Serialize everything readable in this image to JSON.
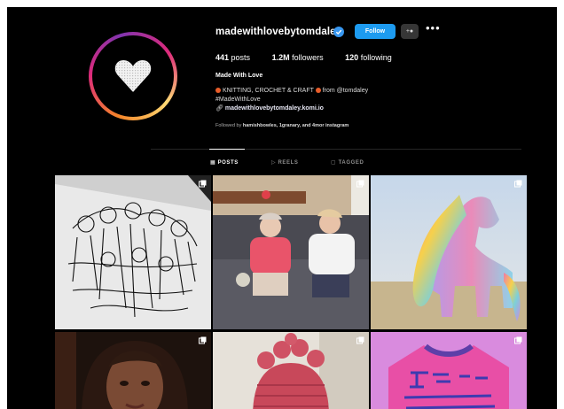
{
  "profile": {
    "username": "madewithlovebytomdaley",
    "follow_label": "Follow",
    "suggest_label": "+‍",
    "more_label": "•••",
    "posts_count": "441",
    "posts_label": "posts",
    "followers_count": "1.2M",
    "followers_label": "followers",
    "following_count": "120",
    "following_label": "following",
    "full_name": "Made With Love",
    "bio_line1": "KNITTING, CROCHET & CRAFT",
    "bio_line1_suffix": "from @tomdaley",
    "bio_line2": "#MadeWithLove",
    "bio_link": "madewithlovebytomdaley.komi.io",
    "followed_prefix": "Followed by",
    "followed_names": "hamishbowles, 1granary, and 4mor",
    "followed_suffix": "instagram"
  },
  "tabs": [
    {
      "label": "POSTS",
      "icon": "grid-icon"
    },
    {
      "label": "REELS",
      "icon": "reels-icon"
    },
    {
      "label": "TAGGED",
      "icon": "tag-icon"
    }
  ],
  "colors": {
    "background": "#000000",
    "follow_button": "#1d9bf0",
    "verified": "#3897f0"
  }
}
